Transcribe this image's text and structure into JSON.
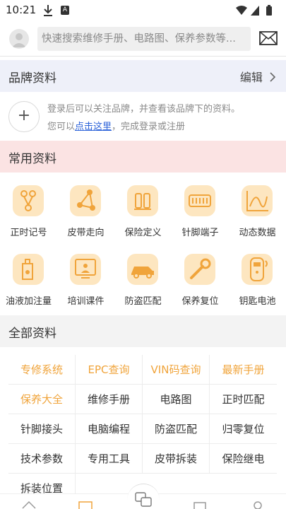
{
  "status": {
    "time": "10:21"
  },
  "search": {
    "placeholder": "快速搜索维修手册、电路图、保养参数等..."
  },
  "brand": {
    "title": "品牌资料",
    "edit": "编辑",
    "login_line1": "登录后可以关注品牌，并查看该品牌下的资料。",
    "login_line2_pre": "您可以",
    "login_link": "点击这里",
    "login_line2_post": "，完成登录或注册"
  },
  "common": {
    "title": "常用资料",
    "items": [
      {
        "label": "正时记号",
        "icon": "timing-mark-icon"
      },
      {
        "label": "皮带走向",
        "icon": "belt-route-icon"
      },
      {
        "label": "保险定义",
        "icon": "fuse-icon"
      },
      {
        "label": "针脚端子",
        "icon": "pin-terminal-icon"
      },
      {
        "label": "动态数据",
        "icon": "live-data-icon"
      },
      {
        "label": "油液加注量",
        "icon": "oil-capacity-icon"
      },
      {
        "label": "培训课件",
        "icon": "training-icon"
      },
      {
        "label": "防盗匹配",
        "icon": "anti-theft-icon"
      },
      {
        "label": "保养复位",
        "icon": "service-reset-icon"
      },
      {
        "label": "钥匙电池",
        "icon": "key-battery-icon"
      }
    ]
  },
  "all": {
    "title": "全部资料",
    "cells": [
      "专修系统",
      "EPC查询",
      "VIN码查询",
      "最新手册",
      "保养大全",
      "维修手册",
      "电路图",
      "正时匹配",
      "针脚接头",
      "电脑编程",
      "防盗匹配",
      "归零复位",
      "技术参数",
      "专用工具",
      "皮带拆装",
      "保险继电",
      "拆装位置"
    ],
    "highlighted": [
      0,
      1,
      2,
      3,
      4
    ]
  },
  "colors": {
    "accent": "#f0a43b",
    "icon_bg": "#fde6c0",
    "link": "#2b62d9"
  }
}
